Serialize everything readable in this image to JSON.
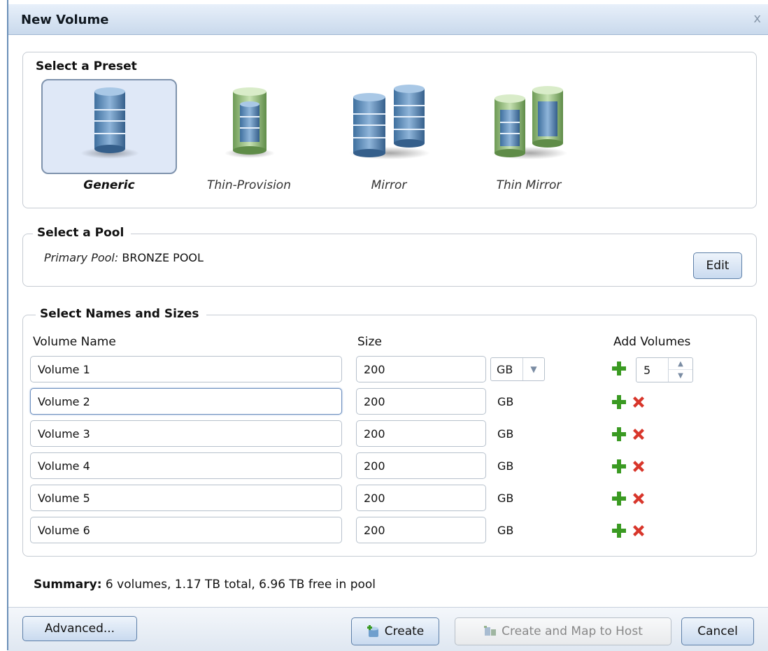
{
  "dialog": {
    "title": "New Volume",
    "close_glyph": "x"
  },
  "presets": {
    "legend": "Select a Preset",
    "items": [
      {
        "label": "Generic",
        "icon": "database-icon",
        "selected": true
      },
      {
        "label": "Thin-Provision",
        "icon": "thin-database-icon",
        "selected": false
      },
      {
        "label": "Mirror",
        "icon": "mirror-database-icon",
        "selected": false
      },
      {
        "label": "Thin Mirror",
        "icon": "thin-mirror-database-icon",
        "selected": false
      }
    ]
  },
  "pool": {
    "legend": "Select a Pool",
    "label": "Primary Pool:",
    "value": "BRONZE POOL",
    "edit_label": "Edit"
  },
  "names_sizes": {
    "legend": "Select Names and Sizes",
    "col_name": "Volume Name",
    "col_size": "Size",
    "col_add": "Add Volumes",
    "unit_select": "GB",
    "add_count": "5",
    "rows": [
      {
        "name": "Volume 1",
        "size": "200",
        "unit": "GB"
      },
      {
        "name": "Volume 2",
        "size": "200",
        "unit": "GB"
      },
      {
        "name": "Volume 3",
        "size": "200",
        "unit": "GB"
      },
      {
        "name": "Volume 4",
        "size": "200",
        "unit": "GB"
      },
      {
        "name": "Volume 5",
        "size": "200",
        "unit": "GB"
      },
      {
        "name": "Volume 6",
        "size": "200",
        "unit": "GB"
      }
    ]
  },
  "summary": {
    "label": "Summary:",
    "text": "6 volumes, 1.17 TB total, 6.96 TB free in pool"
  },
  "footer": {
    "advanced": "Advanced...",
    "create": "Create",
    "create_map": "Create and Map to Host",
    "cancel": "Cancel"
  },
  "colors": {
    "title_bar": "#c9d9ec",
    "selected_preset": "#dfe8f7",
    "add_icon": "#3a9a22",
    "remove_icon": "#d8362b"
  }
}
